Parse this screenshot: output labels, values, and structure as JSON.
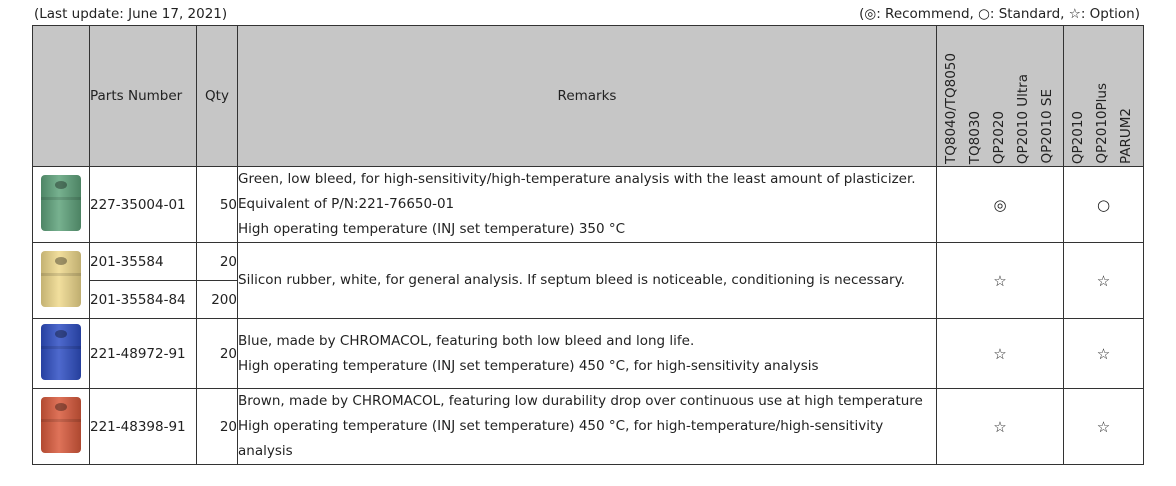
{
  "header": {
    "last_update": "(Last update: June 17, 2021)",
    "legend": "(◎: Recommend, ○: Standard, ☆: Option)"
  },
  "table": {
    "columns": {
      "parts_number": "Parts Number",
      "qty": "Qty",
      "remarks": "Remarks",
      "group1": [
        "TQ8040/TQ8050",
        "TQ8030",
        "QP2020",
        "QP2010 Ultra",
        "QP2010 SE"
      ],
      "group2": [
        "QP2010",
        "QP2010Plus",
        "PARUM2"
      ]
    },
    "rows": [
      {
        "image": "green-septum",
        "color": "#5fa37c",
        "parts": [
          {
            "number": "227-35004-01",
            "qty": "50"
          }
        ],
        "remarks": [
          "Green, low bleed, for high-sensitivity/high-temperature analysis with the least amount of plasticizer.",
          "Equivalent of P/N:221-76650-01",
          "High operating temperature (INJ set temperature) 350 °C"
        ],
        "mark1": "◎",
        "mark2": "○"
      },
      {
        "image": "white-septum",
        "color": "#efd98c",
        "parts": [
          {
            "number": "201-35584",
            "qty": "20"
          },
          {
            "number": "201-35584-84",
            "qty": "200"
          }
        ],
        "remarks": [
          "Silicon rubber, white, for general analysis. If septum bleed is noticeable, conditioning is necessary."
        ],
        "mark1": "☆",
        "mark2": "☆"
      },
      {
        "image": "blue-septum",
        "color": "#2f4fc4",
        "parts": [
          {
            "number": "221-48972-91",
            "qty": "20"
          }
        ],
        "remarks": [
          "Blue, made by CHROMACOL, featuring both low bleed and long life.",
          "High operating temperature (INJ set temperature) 450 °C, for high-sensitivity analysis"
        ],
        "mark1": "☆",
        "mark2": "☆"
      },
      {
        "image": "brown-septum",
        "color": "#d95a3c",
        "parts": [
          {
            "number": "221-48398-91",
            "qty": "20"
          }
        ],
        "remarks": [
          "Brown, made by CHROMACOL, featuring low durability drop over continuous use at high temperature",
          "High operating temperature (INJ set temperature) 450 °C, for high-temperature/high-sensitivity",
          "analysis"
        ],
        "mark1": "☆",
        "mark2": "☆"
      }
    ]
  }
}
